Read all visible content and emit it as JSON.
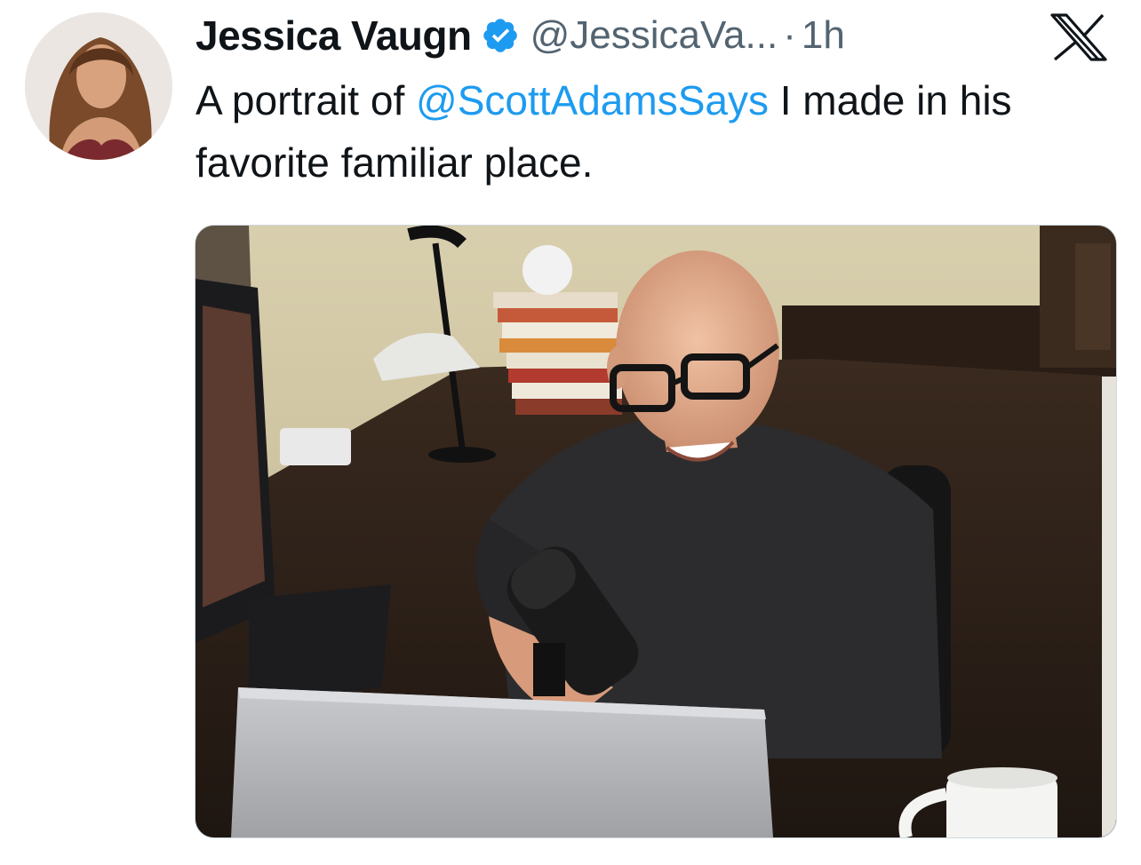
{
  "author": {
    "display_name": "Jessica Vaugn",
    "verified": true,
    "handle": "@JessicaVa...",
    "separator": "·",
    "timestamp": "1h"
  },
  "tweet": {
    "text_before": "A portrait of ",
    "mention": "@ScottAdamsSays",
    "text_after": " I made in his favorite familiar place."
  },
  "icons": {
    "avatar": "avatar-photo",
    "verified": "verified-badge-icon",
    "brand": "x-logo-icon",
    "media": "photo-portrait-man-at-desk-with-laptop-and-microphone"
  },
  "colors": {
    "link": "#1d9bf0",
    "secondary_text": "#536471",
    "primary_text": "#0f1419",
    "badge": "#1d9bf0"
  }
}
